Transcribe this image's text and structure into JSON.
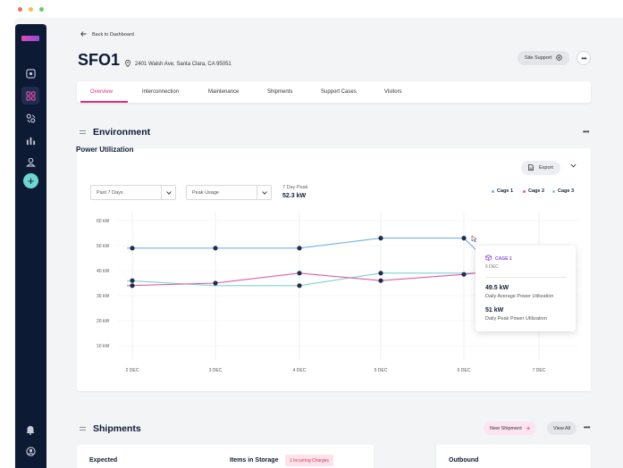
{
  "window": {
    "traffic_lights": [
      "#f26b6b",
      "#f5c04a",
      "#5ccf6e"
    ]
  },
  "sidebar": {
    "icons": [
      "monitor-icon",
      "apps-icon",
      "tools-icon",
      "bar-chart-icon",
      "user-icon"
    ],
    "active_index": 1,
    "fab_label": "+",
    "bottom_icons": [
      "bell-icon",
      "account-icon"
    ]
  },
  "header": {
    "back_label": "Back to Dashboard",
    "title": "SFO1",
    "address": "2401 Walsh Ave, Santa Clara, CA 95051",
    "site_support_label": "Site Support",
    "more_label": "•••"
  },
  "tabs": [
    {
      "label": "Overview",
      "active": true
    },
    {
      "label": "Interconnection",
      "active": false
    },
    {
      "label": "Maintenance",
      "active": false
    },
    {
      "label": "Shipments",
      "active": false
    },
    {
      "label": "Support Cases",
      "active": false
    },
    {
      "label": "Visitors",
      "active": false
    }
  ],
  "environment": {
    "section_title": "Environment",
    "more_label": "•••",
    "card_title": "Power Utilization",
    "export_label": "Export",
    "range_select": "Past 7 Days",
    "metric_select": "Peak Usage",
    "peak_label": "7 Day Peak",
    "peak_value": "52.3 kW",
    "legend": [
      {
        "name": "Cage 1",
        "color": "#7aaee8"
      },
      {
        "name": "Cage 2",
        "color": "#e05aa8"
      },
      {
        "name": "Cage 3",
        "color": "#7fd1cc"
      }
    ],
    "tooltip": {
      "cage": "CAGE 1",
      "date": "6 DEC",
      "avg_value": "49.5 kW",
      "avg_label": "Daily Average Power Utilization",
      "peak_value": "51 kW",
      "peak_label": "Daily Peak Power Utilization"
    }
  },
  "chart_data": {
    "type": "line",
    "x": [
      "2 DEC",
      "3 DEC",
      "4 DEC",
      "5 DEC",
      "6 DEC",
      "7 DEC"
    ],
    "ylim": [
      0,
      60
    ],
    "yticks": [
      "60 kW",
      "50 kW",
      "40 kW",
      "30 kW",
      "20 kW",
      "10 kW"
    ],
    "ytick_values": [
      60,
      50,
      40,
      30,
      20,
      10
    ],
    "grid": true,
    "legend_position": "top-right",
    "series": [
      {
        "name": "Cage 1",
        "color": "#7aaee8",
        "values": [
          49,
          49,
          49,
          53,
          53,
          48.5
        ]
      },
      {
        "name": "Cage 2",
        "color": "#e05aa8",
        "values": [
          34,
          35,
          39,
          36,
          38.5,
          39
        ]
      },
      {
        "name": "Cage 3",
        "color": "#7fd1cc",
        "values": [
          36,
          34,
          34,
          39,
          39,
          39
        ]
      }
    ],
    "markers": [
      {
        "series": 0,
        "index": 0
      },
      {
        "series": 0,
        "index": 1
      },
      {
        "series": 0,
        "index": 2
      },
      {
        "series": 0,
        "index": 3
      },
      {
        "series": 0,
        "index": 4
      },
      {
        "series": 1,
        "index": 0
      },
      {
        "series": 1,
        "index": 1
      },
      {
        "series": 1,
        "index": 2
      },
      {
        "series": 1,
        "index": 3
      },
      {
        "series": 1,
        "index": 4
      },
      {
        "series": 2,
        "index": 0
      },
      {
        "series": 2,
        "index": 2
      },
      {
        "series": 2,
        "index": 3
      }
    ]
  },
  "shipments": {
    "section_title": "Shipments",
    "new_shipment_label": "New Shipment",
    "view_all_label": "View All",
    "more_label": "•••",
    "expected_label": "Expected",
    "items_in_storage_label": "Items in Storage",
    "incurring_charges_label": "1 Incurring Charges",
    "outbound_label": "Outbound"
  }
}
